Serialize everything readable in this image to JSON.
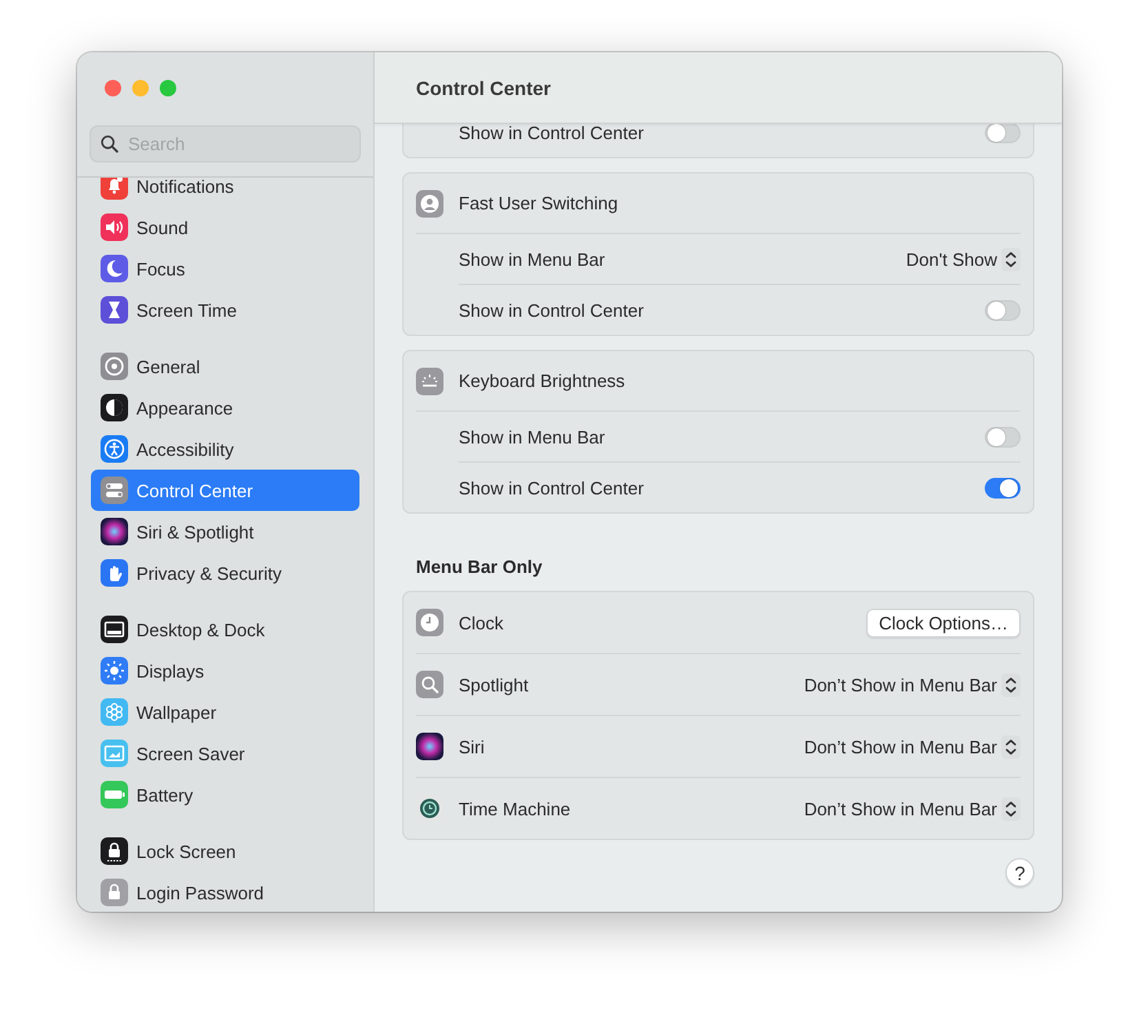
{
  "window": {
    "title": "Control Center"
  },
  "sidebar": {
    "search": {
      "placeholder": "Search"
    },
    "groups": [
      {
        "items": [
          {
            "label": "Notifications",
            "selected": false
          },
          {
            "label": "Sound",
            "selected": false
          },
          {
            "label": "Focus",
            "selected": false
          },
          {
            "label": "Screen Time",
            "selected": false
          }
        ]
      },
      {
        "items": [
          {
            "label": "General",
            "selected": false
          },
          {
            "label": "Appearance",
            "selected": false
          },
          {
            "label": "Accessibility",
            "selected": false
          },
          {
            "label": "Control Center",
            "selected": true
          },
          {
            "label": "Siri & Spotlight",
            "selected": false
          },
          {
            "label": "Privacy & Security",
            "selected": false
          }
        ]
      },
      {
        "items": [
          {
            "label": "Desktop & Dock",
            "selected": false
          },
          {
            "label": "Displays",
            "selected": false
          },
          {
            "label": "Wallpaper",
            "selected": false
          },
          {
            "label": "Screen Saver",
            "selected": false
          },
          {
            "label": "Battery",
            "selected": false
          }
        ]
      },
      {
        "items": [
          {
            "label": "Lock Screen",
            "selected": false
          },
          {
            "label": "Login Password",
            "selected": false
          }
        ]
      }
    ]
  },
  "sections": [
    {
      "cards": [
        {
          "rows": [
            {
              "kind": "toggle",
              "label": "Show in Control Center",
              "on": false
            }
          ]
        },
        {
          "rows": [
            {
              "kind": "header",
              "label": "Fast User Switching"
            },
            {
              "kind": "popup",
              "label": "Show in Menu Bar",
              "value": "Don't Show"
            },
            {
              "kind": "toggle",
              "label": "Show in Control Center",
              "on": false
            }
          ]
        },
        {
          "rows": [
            {
              "kind": "header",
              "label": "Keyboard Brightness"
            },
            {
              "kind": "toggle",
              "label": "Show in Menu Bar",
              "on": false
            },
            {
              "kind": "toggle",
              "label": "Show in Control Center",
              "on": true
            }
          ]
        }
      ]
    },
    {
      "title": "Menu Bar Only",
      "cards": [
        {
          "rows": [
            {
              "kind": "button",
              "label": "Clock",
              "button": "Clock Options…"
            },
            {
              "kind": "popup_icon",
              "label": "Spotlight",
              "value": "Don’t Show in Menu Bar"
            },
            {
              "kind": "popup_icon",
              "label": "Siri",
              "value": "Don’t Show in Menu Bar"
            },
            {
              "kind": "popup_icon",
              "label": "Time Machine",
              "value": "Don’t Show in Menu Bar"
            }
          ]
        }
      ]
    }
  ],
  "help": {
    "label": "?"
  }
}
